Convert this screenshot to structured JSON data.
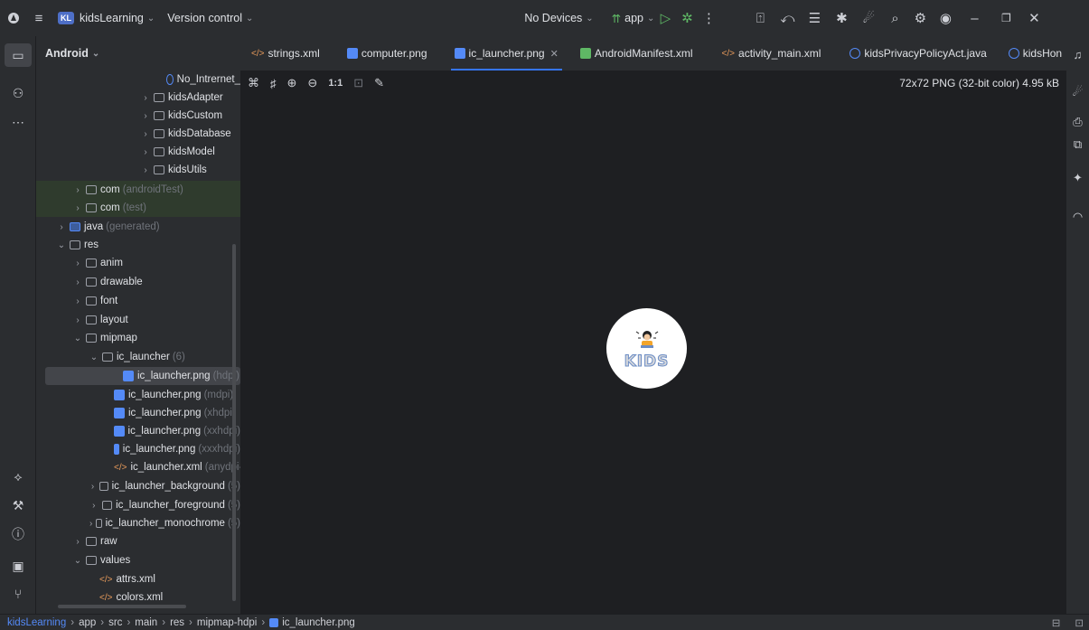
{
  "titlebar": {
    "project_badge": "KL",
    "project_name": "kidsLearning",
    "vcs": "Version control",
    "devices": "No Devices",
    "run_config": "app"
  },
  "project_panel": {
    "view": "Android",
    "tree": [
      {
        "label": "No_Intrernet_",
        "hint": "",
        "kind": "class"
      },
      {
        "label": "kidsAdapter",
        "hint": "",
        "kind": "folder"
      },
      {
        "label": "kidsCustom",
        "hint": "",
        "kind": "folder"
      },
      {
        "label": "kidsDatabase",
        "hint": "",
        "kind": "folder"
      },
      {
        "label": "kidsModel",
        "hint": "",
        "kind": "folder"
      },
      {
        "label": "kidsUtils",
        "hint": "",
        "kind": "folder"
      },
      {
        "label": "com",
        "hint": "(androidTest)",
        "kind": "folder"
      },
      {
        "label": "com",
        "hint": "(test)",
        "kind": "folder"
      },
      {
        "label": "java",
        "hint": "(generated)",
        "kind": "folder"
      },
      {
        "label": "res",
        "hint": "",
        "kind": "folder"
      },
      {
        "label": "anim",
        "hint": "",
        "kind": "folder"
      },
      {
        "label": "drawable",
        "hint": "",
        "kind": "folder"
      },
      {
        "label": "font",
        "hint": "",
        "kind": "folder"
      },
      {
        "label": "layout",
        "hint": "",
        "kind": "folder"
      },
      {
        "label": "mipmap",
        "hint": "",
        "kind": "folder"
      },
      {
        "label": "ic_launcher",
        "hint": "(6)",
        "kind": "folder"
      },
      {
        "label": "ic_launcher.png",
        "hint": "(hdpi)",
        "kind": "image"
      },
      {
        "label": "ic_launcher.png",
        "hint": "(mdpi)",
        "kind": "image"
      },
      {
        "label": "ic_launcher.png",
        "hint": "(xhdpi)",
        "kind": "image"
      },
      {
        "label": "ic_launcher.png",
        "hint": "(xxhdpi)",
        "kind": "image"
      },
      {
        "label": "ic_launcher.png",
        "hint": "(xxxhdpi)",
        "kind": "image"
      },
      {
        "label": "ic_launcher.xml",
        "hint": "(anydpi-v",
        "kind": "xml"
      },
      {
        "label": "ic_launcher_background",
        "hint": "(5)",
        "kind": "folder"
      },
      {
        "label": "ic_launcher_foreground",
        "hint": "(5)",
        "kind": "folder"
      },
      {
        "label": "ic_launcher_monochrome",
        "hint": "(5)",
        "kind": "folder"
      },
      {
        "label": "raw",
        "hint": "",
        "kind": "folder"
      },
      {
        "label": "values",
        "hint": "",
        "kind": "folder"
      },
      {
        "label": "attrs.xml",
        "hint": "",
        "kind": "xml"
      },
      {
        "label": "colors.xml",
        "hint": "",
        "kind": "xml"
      }
    ]
  },
  "tabs": [
    {
      "label": "strings.xml"
    },
    {
      "label": "computer.png"
    },
    {
      "label": "ic_launcher.png"
    },
    {
      "label": "AndroidManifest.xml"
    },
    {
      "label": "activity_main.xml"
    },
    {
      "label": "kidsPrivacyPolicyAct.java"
    },
    {
      "label": "kidsHon"
    }
  ],
  "image_viewer": {
    "info": "72x72 PNG (32-bit color) 4.95 kB",
    "zoom_actual": "1:1",
    "preview_text": "KIDS"
  },
  "breadcrumb": [
    "kidsLearning",
    "app",
    "src",
    "main",
    "res",
    "mipmap-hdpi",
    "ic_launcher.png"
  ],
  "colors": {
    "accent": "#3574f0",
    "background": "#1e1f22",
    "panel": "#2b2d30",
    "green_row": "#2f3b2d"
  }
}
